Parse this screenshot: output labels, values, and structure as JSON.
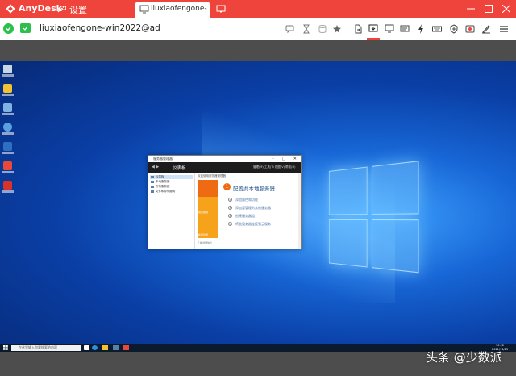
{
  "app": {
    "name": "AnyDesk",
    "accent": "#ef443b"
  },
  "tabs": [
    {
      "label": "设置",
      "icon": "wrench-icon"
    },
    {
      "label": "liuxiaofengone-wi...",
      "icon": "monitor-icon"
    }
  ],
  "window_controls": [
    "minimize",
    "maximize",
    "close"
  ],
  "toolbar": {
    "address": "liuxiaofengone-win2022@ad",
    "status_color": "#2dbe4c",
    "actions": [
      "chat-bubbles-icon",
      "hourglass-icon",
      "database-icon",
      "star-icon",
      "file-transfer-icon",
      "display-icon",
      "monitor-icon",
      "chat-icon",
      "lightning-icon",
      "keyboard-icon",
      "shield-icon",
      "record-icon",
      "pen-icon",
      "menu-icon"
    ]
  },
  "remote": {
    "server_manager": {
      "title": "服务器管理器",
      "breadcrumb": "仪表板",
      "nav_menu": "管理(M)  工具(T)  视图(V)  帮助(H)",
      "welcome": "欢迎使用服务器管理器",
      "sidebar": [
        "仪表板",
        "本地服务器",
        "所有服务器",
        "文件和存储服务"
      ],
      "quick_start": "快速启动",
      "whats_new": "新增功能",
      "learn_more": "了解详细信息",
      "card_number": "1",
      "card_title": "配置此本地服务器",
      "steps": [
        "添加角色和功能",
        "添加要管理的其他服务器",
        "创建服务器组",
        "将此服务器连接到云服务"
      ],
      "footer": "隐藏"
    },
    "taskbar": {
      "search_placeholder": "在这里输入你要搜索的内容",
      "time": "10:22",
      "date": "2021/11/25"
    }
  },
  "watermark": "头条 @少数派"
}
